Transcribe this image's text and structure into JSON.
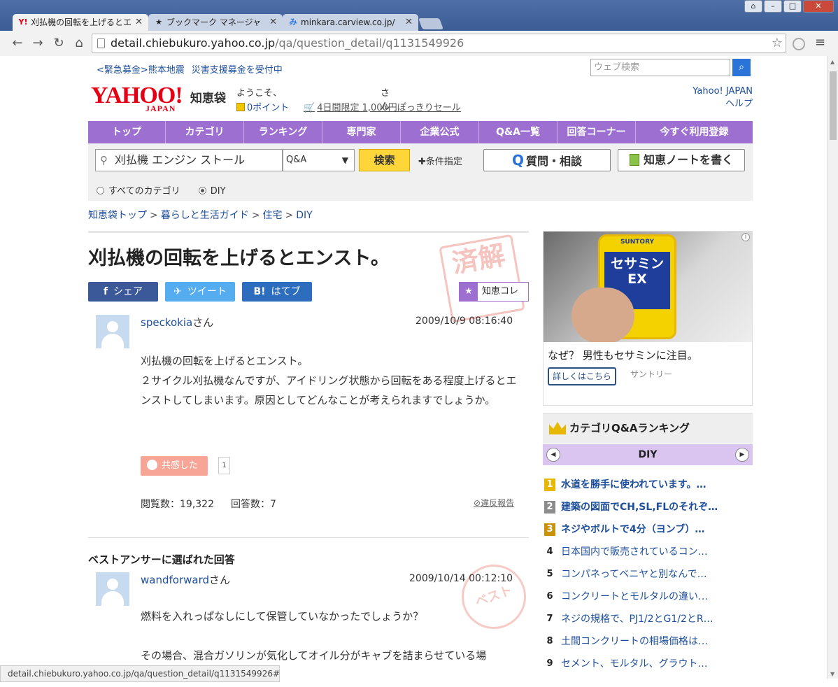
{
  "browser": {
    "tabs": [
      {
        "label": "刈払機の回転を上げるとエ",
        "favicon": "Y!",
        "active": true
      },
      {
        "label": "ブックマーク マネージャ",
        "favicon": "★",
        "active": false
      },
      {
        "label": "minkara.carview.co.jp/",
        "favicon": "み",
        "active": false
      }
    ],
    "url_host": "detail.chiebukuro.yahoo.co.jp",
    "url_path": "/qa/question_detail/q1131549926",
    "window_buttons": {
      "minimize": "–",
      "maximize": "□",
      "close": "✕"
    }
  },
  "header": {
    "notice_1": "<緊急募金>熊本地震",
    "notice_2": "災害支援募金を受付中",
    "websearch_placeholder": "ウェブ検索",
    "logo_text": "YAHOO!",
    "logo_sub": "JAPAN",
    "site_name": "知恵袋",
    "welcome": "ようこそ、",
    "welcome_suffix": "さん",
    "points": "0ポイント",
    "sale": "4日間限定 1,000円ぽっきりセール",
    "link_yahoo": "Yahoo! JAPAN",
    "link_help": "ヘルプ"
  },
  "gnav": [
    {
      "label": "トップ"
    },
    {
      "label": "カテゴリ"
    },
    {
      "label": "ランキング"
    },
    {
      "label": "専門家"
    },
    {
      "label": "企業公式"
    },
    {
      "label": "Q&A一覧"
    },
    {
      "label": "回答コーナー"
    },
    {
      "label": "今すぐ利用登録"
    }
  ],
  "search": {
    "query": "刈払機 エンジン ストール",
    "scope": "Q&A",
    "submit": "検索",
    "conditions": "条件指定",
    "ask": "質問・相談",
    "write_note": "知恵ノートを書く",
    "radio_all": "すべてのカテゴリ",
    "radio_diy": "DIY"
  },
  "breadcrumb": [
    "知恵袋トップ",
    "暮らしと生活ガイド",
    "住宅",
    "DIY"
  ],
  "question": {
    "title": "刈払機の回転を上げるとエンスト。",
    "stamp": "済解",
    "share_fb": "シェア",
    "share_tw": "ツイート",
    "share_hb": "はてブ",
    "fav": "知恵コレ",
    "user": "speckokia",
    "user_suffix": "さん",
    "datetime": "2009/10/9  08:16:40",
    "body_1": "刈払機の回転を上げるとエンスト。",
    "body_2": "２サイクル刈払機なんですが、アイドリング状態から回転をある程度上げるとエンストしてしまいます。原因としてどんなことが考えられますでしょうか。",
    "empathy": "共感した",
    "empathy_count": "1",
    "views": "閲覧数：19,322",
    "answers": "回答数：7",
    "report": "違反報告"
  },
  "best_answer": {
    "label": "ベストアンサーに選ばれた回答",
    "stamp": "ベスト",
    "user": "wandforward",
    "user_suffix": "さん",
    "datetime": "2009/10/14  00:12:10",
    "body_1": "燃料を入れっぱなしにして保管していなかったでしょうか？",
    "body_2": "その場合、混合ガソリンが気化してオイル分がキャブを詰まらせている場"
  },
  "ad": {
    "brand": "SUNTORY",
    "product": "セサミンEX",
    "title": "なぜ？ 男性もセサミンに注目。",
    "button": "詳しくはこちら",
    "sponsor": "サントリー"
  },
  "ranking": {
    "title": "カテゴリQ&Aランキング",
    "category": "DIY",
    "items": [
      {
        "rank": "1",
        "text": "水道を勝手に使われています。…",
        "color": "#e8b800"
      },
      {
        "rank": "2",
        "text": "建築の図面でCH,SL,FLのそれぞ…",
        "color": "#8c8c8c"
      },
      {
        "rank": "3",
        "text": "ネジやボルトで4分（ヨンブ）…",
        "color": "#c9920a"
      },
      {
        "rank": "4",
        "text": "日本国内で販売されているコン…"
      },
      {
        "rank": "5",
        "text": "コンパネってベニヤと別なんで…"
      },
      {
        "rank": "6",
        "text": "コンクリートとモルタルの違い…"
      },
      {
        "rank": "7",
        "text": "ネジの規格で、PJ1/2とG1/2とR…"
      },
      {
        "rank": "8",
        "text": "土間コンクリートの相場価格は…"
      },
      {
        "rank": "9",
        "text": "セメント、モルタル、グラウト…"
      }
    ]
  },
  "status_url": "detail.chiebukuro.yahoo.co.jp/qa/question_detail/q1131549926#"
}
